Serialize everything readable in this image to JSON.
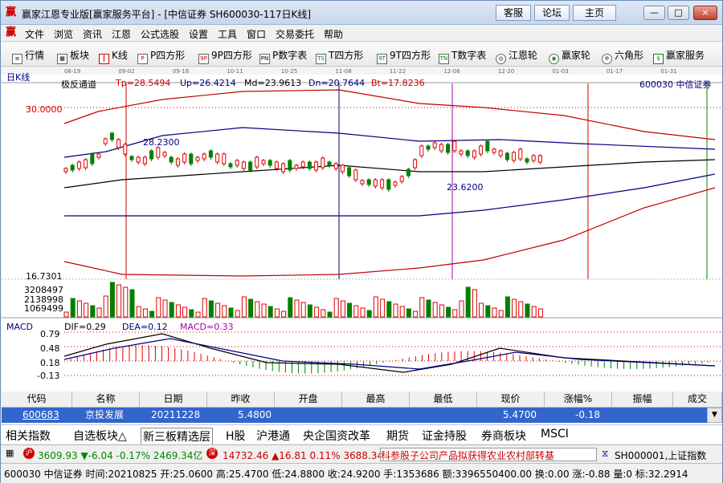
{
  "window": {
    "title": "赢家江恩专业版[赢家服务平台] - [中信证券  SH600030-117日K线]",
    "buttons": [
      "客服",
      "论坛",
      "主页"
    ],
    "controls": [
      "—",
      "□",
      "×"
    ]
  },
  "menu": [
    "文件",
    "浏览",
    "资讯",
    "江恩",
    "公式选股",
    "设置",
    "工具",
    "窗口",
    "交易委托",
    "帮助"
  ],
  "toolbar": [
    {
      "icon": "quote-icon",
      "label": "行情"
    },
    {
      "icon": "sector-icon",
      "label": "板块"
    },
    {
      "icon": "candle-icon",
      "label": "K线"
    },
    {
      "icon": "P",
      "label": "P四方形"
    },
    {
      "icon": "9P",
      "label": "9P四方形"
    },
    {
      "icon": "PN",
      "label": "P数字表"
    },
    {
      "icon": "TS",
      "label": "T四方形"
    },
    {
      "icon": "9T",
      "label": "9T四方形"
    },
    {
      "icon": "TN",
      "label": "T数字表"
    },
    {
      "icon": "gann-wheel-icon",
      "label": "江恩轮"
    },
    {
      "icon": "winner-wheel-icon",
      "label": "赢家轮"
    },
    {
      "icon": "hexagon-icon",
      "label": "六角形"
    },
    {
      "icon": "dollar-icon",
      "label": "赢家服务"
    }
  ],
  "chart": {
    "period_label": "日K线",
    "dates": [
      "08-19",
      "09-02",
      "09-16",
      "10-11",
      "10-25",
      "11-08",
      "11-22",
      "12-06",
      "12-20",
      "01-03",
      "01-17",
      "01-31"
    ],
    "indicator": "极反通道",
    "tp": "Tp=28.5494",
    "up": "Up=26.4214",
    "md": "Md=23.9613",
    "dn": "Dn=20.7644",
    "bt": "Bt=17.8236",
    "stock": "600030  中信证券",
    "high_axis": "30.0000",
    "low_axis": "16.7301",
    "peak_label": "28.2300",
    "trough_label": "23.6200",
    "volume_axis": [
      "3208497",
      "2138998",
      "1069499"
    ],
    "macd_title": "MACD",
    "dif": "DIF=0.29",
    "dea": "DEA=0.12",
    "macd": "MACD=0.33",
    "macd_axis": [
      "0.79",
      "0.48",
      "0.18",
      "-0.13"
    ],
    "colors": {
      "up": "#e00000",
      "down": "#008000",
      "band": "#c00000",
      "mid": "#000080"
    }
  },
  "table": {
    "headers": [
      "代码",
      "名称",
      "日期",
      "昨收",
      "开盘",
      "最高",
      "最低",
      "现价",
      "涨幅%",
      "振幅",
      "成交"
    ],
    "row": [
      "600683",
      "京投发展",
      "20211228",
      "5.4800",
      "",
      "",
      "",
      "5.4700",
      "-0.18",
      "",
      ""
    ]
  },
  "tabs": [
    "相关指数",
    "自选板块△",
    "新三板精选层",
    "H股",
    "沪港通",
    "央企国资改革",
    "期货",
    "证金持股",
    "券商板块",
    "MSCI"
  ],
  "ticker": {
    "sh": "3609.93 ▼-6.04 -0.17% 2469.34亿",
    "sz": "14732.46 ▲16.81 0.11% 3688.34亿",
    "news": "科参股子公司产品拟获得农业农村部转基",
    "index": "SH000001,上证指数"
  },
  "status": "600030 中信证券 时间:20210825 开:25.0600 高:25.4700 低:24.8800 收:24.9200 手:1353686 额:3396550400.00 换:0.00 涨:-0.88 量:0 标:32.2914"
}
